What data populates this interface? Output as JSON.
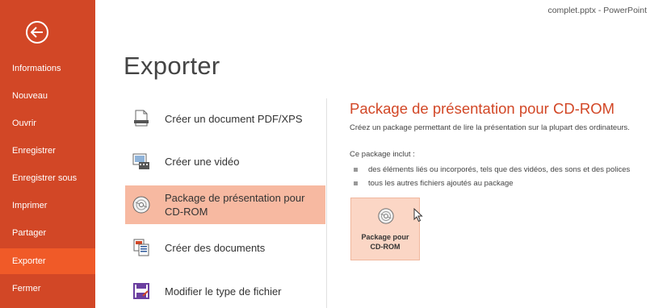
{
  "window_title": "complet.pptx - PowerPoint",
  "accent_color": "#d24726",
  "sidebar": {
    "back_icon": "back-arrow-icon",
    "items": [
      {
        "label": "Informations"
      },
      {
        "label": "Nouveau"
      },
      {
        "label": "Ouvrir"
      },
      {
        "label": "Enregistrer"
      },
      {
        "label": "Enregistrer sous"
      },
      {
        "label": "Imprimer"
      },
      {
        "label": "Partager"
      },
      {
        "label": "Exporter",
        "selected": true
      },
      {
        "label": "Fermer"
      }
    ]
  },
  "page_title": "Exporter",
  "options": [
    {
      "label": "Créer un document PDF/XPS",
      "icon": "pdf-document-icon"
    },
    {
      "label": "Créer une vidéo",
      "icon": "video-icon"
    },
    {
      "label": "Package de présentation pour CD-ROM",
      "icon": "cd-icon",
      "selected": true
    },
    {
      "label": "Créer des documents",
      "icon": "handouts-icon"
    },
    {
      "label": "Modifier le type de fichier",
      "icon": "file-type-icon"
    }
  ],
  "detail": {
    "title": "Package de présentation pour CD-ROM",
    "description": "Créez un package permettant de lire la présentation sur la plupart des ordinateurs.",
    "includes_label": "Ce package inclut :",
    "bullets": [
      "des éléments liés ou incorporés, tels que des vidéos, des sons et des polices",
      "tous les autres fichiers ajoutés au package"
    ],
    "button_label_line1": "Package pour",
    "button_label_line2": "CD-ROM"
  }
}
